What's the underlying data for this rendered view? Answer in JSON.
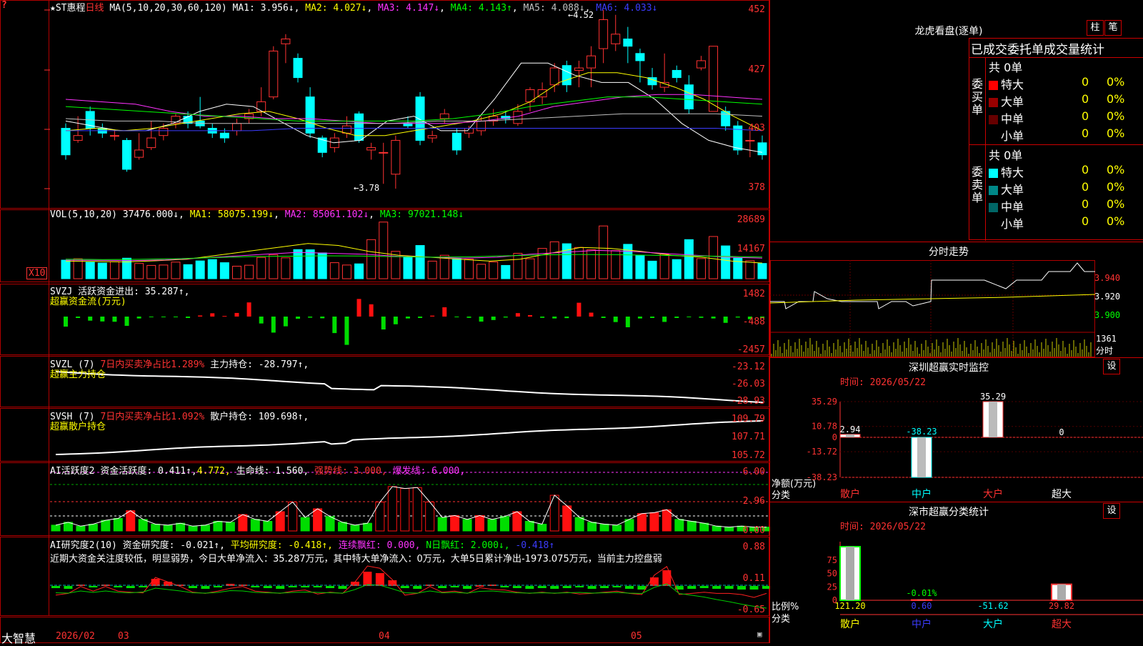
{
  "stock": {
    "name": "★ST惠程",
    "period": "日线"
  },
  "ma": {
    "label": "MA(5,10,20,30,60,120)",
    "ma1": "MA1: 3.956↓",
    "ma2": "MA2: 4.027↓",
    "ma3": "MA3: 4.147↓",
    "ma4": "MA4: 4.143↑",
    "ma5": "MA5: 4.088↓",
    "ma6": "MA6: 4.033↓"
  },
  "price_axis": [
    "452",
    "427",
    "403",
    "378"
  ],
  "annot": {
    "high": "4.52",
    "low": "3.78"
  },
  "vol": {
    "label": "VOL(5,10,20)",
    "value": "37476.000↓",
    "ma1": "MA1: 58075.199↓",
    "ma2": "MA2: 85061.102↓",
    "ma3": "MA3: 97021.148↓",
    "axis": [
      "28689",
      "14167"
    ],
    "unit": "X10"
  },
  "svzj": {
    "label": "SVZJ",
    "active": "活跃资金进出: 35.287↑,",
    "sub": "超赢资金流(万元)",
    "axis": [
      "1482",
      "-488",
      "-2457"
    ]
  },
  "svzl": {
    "label": "SVZL (7)",
    "ratio": "7日内买卖净占比1.289%",
    "hold": "主力持仓: -28.797↑,",
    "sub": "超赢主力持仓",
    "axis": [
      "-23.12",
      "-26.03",
      "-28.93"
    ]
  },
  "svsh": {
    "label": "SVSH (7)",
    "ratio": "7日内买卖净占比1.092%",
    "hold": "散户持仓: 109.698↑,",
    "sub": "超赢散户持仓",
    "axis": [
      "109.79",
      "107.71",
      "105.72"
    ]
  },
  "ai1": {
    "label": "AI活跃度2",
    "a": "资金活跃度: 0.411↑,",
    "b": "4.772,",
    "c": "生命线: 1.560,",
    "d": "强势线: 3.000,",
    "e": "爆发线: 6.000,",
    "axis": [
      "6.00",
      "2.96",
      "0.00"
    ]
  },
  "ai2": {
    "label": "AI研究度2(10)",
    "a": "资金研究度: -0.021↑,",
    "b": "平均研究度: -0.418↑,",
    "c": "连续飘红: 0.000,",
    "d": "N日飘红: 2.000↓,",
    "e": "-0.418↑",
    "axis": [
      "0.88",
      "0.11",
      "-0.65"
    ],
    "comment": "近期大资金关注度较低，明显弱势，今日大单净流入：35.287万元，其中特大单净流入：0万元，大单5日累计净出-1973.075万元，当前主力控盘弱"
  },
  "dates": [
    "2026/02",
    "03",
    "04",
    "05"
  ],
  "brand": "大智慧",
  "lhb": {
    "title": "龙虎看盘(逐单)",
    "btn1": "柱",
    "btn2": "笔",
    "subtitle": "已成交委托单成交量统计",
    "buy": {
      "side": "委买单",
      "total": "共 0单",
      "rows": [
        {
          "name": "特大",
          "v": "0",
          "p": "0%",
          "c": "#ff0000"
        },
        {
          "name": "大单",
          "v": "0",
          "p": "0%",
          "c": "#990000"
        },
        {
          "name": "中单",
          "v": "0",
          "p": "0%",
          "c": "#660000"
        },
        {
          "name": "小单",
          "v": "0",
          "p": "0%",
          "c": "#000000"
        }
      ]
    },
    "sell": {
      "side": "委卖单",
      "total": "共 0单",
      "rows": [
        {
          "name": "特大",
          "v": "0",
          "p": "0%",
          "c": "#00ffff"
        },
        {
          "name": "大单",
          "v": "0",
          "p": "0%",
          "c": "#008888"
        },
        {
          "name": "中单",
          "v": "0",
          "p": "0%",
          "c": "#006666"
        },
        {
          "name": "小单",
          "v": "0",
          "p": "0%",
          "c": "#000000"
        }
      ]
    }
  },
  "minute": {
    "title": "分时走势",
    "p1": "3.940",
    "p2": "3.920",
    "p3": "3.900",
    "vol": "1361",
    "vol_label": "分时"
  },
  "sz_mon": {
    "title": "深圳超赢实时监控",
    "btn": "设",
    "time": "时间: 2026/05/22",
    "axis": [
      "35.29",
      "10.78",
      "0",
      "-13.72",
      "-38.23"
    ],
    "unit": "净额(万元)",
    "cat": "分类",
    "bars": [
      {
        "name": "散户",
        "value": 2.94,
        "label": "2.94"
      },
      {
        "name": "中户",
        "value": -38.23,
        "label": "-38.23"
      },
      {
        "name": "大户",
        "value": 35.29,
        "label": "35.29"
      },
      {
        "name": "超大",
        "value": 0,
        "label": "0"
      }
    ]
  },
  "sz_cls": {
    "title": "深市超赢分类统计",
    "btn": "设",
    "time": "时间: 2026/05/22",
    "axis": [
      "75",
      "50",
      "25",
      "0"
    ],
    "unit": "比例%",
    "cat": "分类",
    "bars": [
      {
        "name": "散户",
        "value": 121.2,
        "label": "121.20"
      },
      {
        "name": "中户",
        "value": 0.6,
        "label": "0.60"
      },
      {
        "name": "大户",
        "value": -51.62,
        "label": "-51.62"
      },
      {
        "name": "超大",
        "value": 29.82,
        "label": "29.82"
      }
    ],
    "mid_label": "-0.01%"
  },
  "chart_data": {
    "type": "bar",
    "title": "深圳超赢实时监控",
    "categories": [
      "散户",
      "中户",
      "大户",
      "超大"
    ],
    "values": [
      2.94,
      -38.23,
      35.29,
      0
    ],
    "ylabel": "净额(万元)",
    "ylim": [
      -38.23,
      35.29
    ]
  }
}
